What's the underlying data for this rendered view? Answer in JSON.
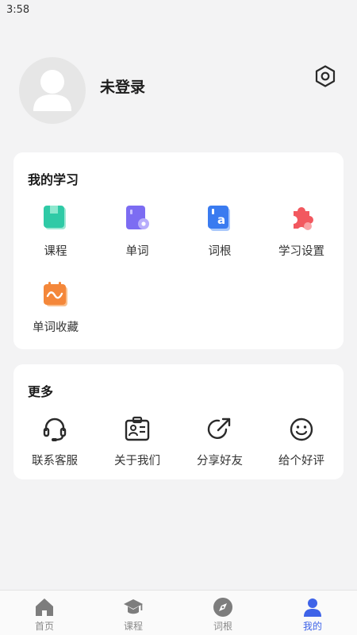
{
  "status_bar": {
    "time": "3:58"
  },
  "profile": {
    "username": "未登录",
    "settings_icon": "hexagon-gear-icon"
  },
  "study": {
    "title": "我的学习",
    "items": [
      {
        "label": "课程",
        "icon": "book-icon",
        "color": "#2fcaa6"
      },
      {
        "label": "单词",
        "icon": "word-card-icon",
        "color": "#7c6cf2"
      },
      {
        "label": "词根",
        "icon": "letter-a-icon",
        "color": "#3a7bf0"
      },
      {
        "label": "学习设置",
        "icon": "puzzle-icon",
        "color": "#f2585f"
      },
      {
        "label": "单词收藏",
        "icon": "calendar-wave-icon",
        "color": "#f4873a"
      }
    ]
  },
  "more": {
    "title": "更多",
    "items": [
      {
        "label": "联系客服",
        "icon": "headset-icon"
      },
      {
        "label": "关于我们",
        "icon": "id-card-icon"
      },
      {
        "label": "分享好友",
        "icon": "share-icon"
      },
      {
        "label": "给个好评",
        "icon": "smile-icon"
      }
    ]
  },
  "nav": {
    "active_color": "#3e63e8",
    "items": [
      {
        "label": "首页",
        "icon": "home-icon"
      },
      {
        "label": "课程",
        "icon": "graduation-cap-icon"
      },
      {
        "label": "词根",
        "icon": "compass-icon"
      },
      {
        "label": "我的",
        "icon": "user-icon",
        "active": true
      }
    ]
  }
}
